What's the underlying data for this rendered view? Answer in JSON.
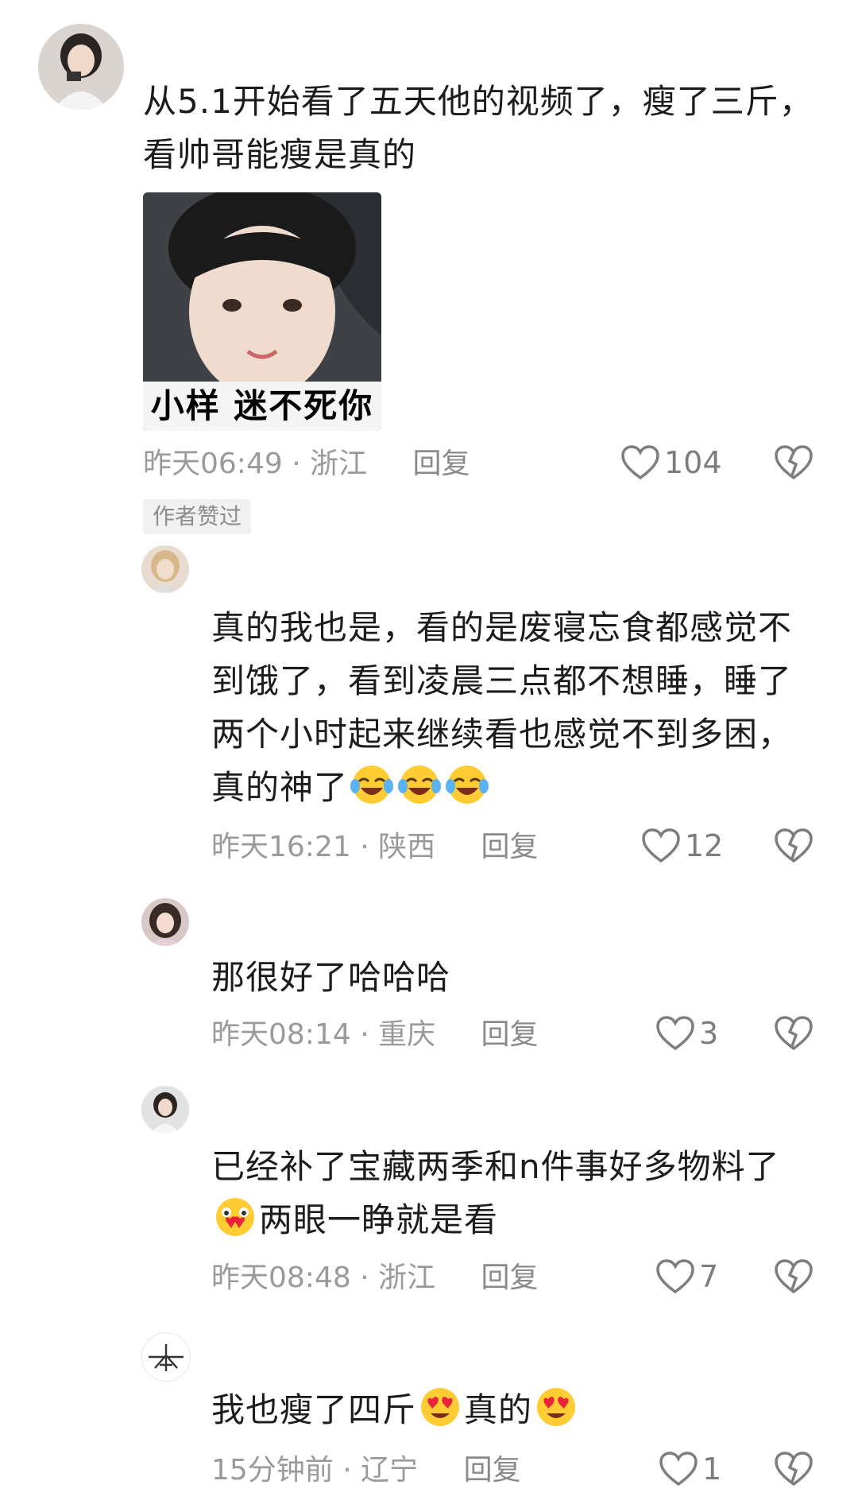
{
  "comments": [
    {
      "text": "从5.1开始看了五天他的视频了，瘦了三斤，看帅哥能瘦是真的",
      "line1": "从5.1开始看了五天他的视频了，瘦了三斤，",
      "line2": "看帅哥能瘦是真的",
      "sticker_caption": "小样 迷不死你",
      "meta": "昨天06:49 · 浙江",
      "reply": "回复",
      "likes": "104",
      "badge": "作者赞过"
    },
    {
      "line1": "真的我也是，看的是废寝忘食都感觉不",
      "line2": "到饿了，看到凌晨三点都不想睡，睡了",
      "line3": "两个小时起来继续看也感觉不到多困，",
      "line4": "真的神了",
      "emoji": "laughing-crying-emoji",
      "meta": "昨天16:21 · 陕西",
      "reply": "回复",
      "likes": "12"
    },
    {
      "line1": "那很好了哈哈哈",
      "meta": "昨天08:14 · 重庆",
      "reply": "回复",
      "likes": "3"
    },
    {
      "line1": "已经补了宝藏两季和n件事好多物料了",
      "line2": "两眼一睁就是看",
      "emoji": "heart-eyes-sob-emoji",
      "meta": "昨天08:48 · 浙江",
      "reply": "回复",
      "likes": "7"
    },
    {
      "line1a": "我也瘦了四斤",
      "line1b": "真的",
      "emoji": "star-struck-hearts-emoji",
      "meta": "15分钟前 · 辽宁",
      "reply": "回复",
      "likes": "1"
    }
  ],
  "colors": {
    "text": "#1c1c1c",
    "meta": "#9a9a9a",
    "icon": "#7d7d7d",
    "badge_bg": "#f1f1f1"
  }
}
